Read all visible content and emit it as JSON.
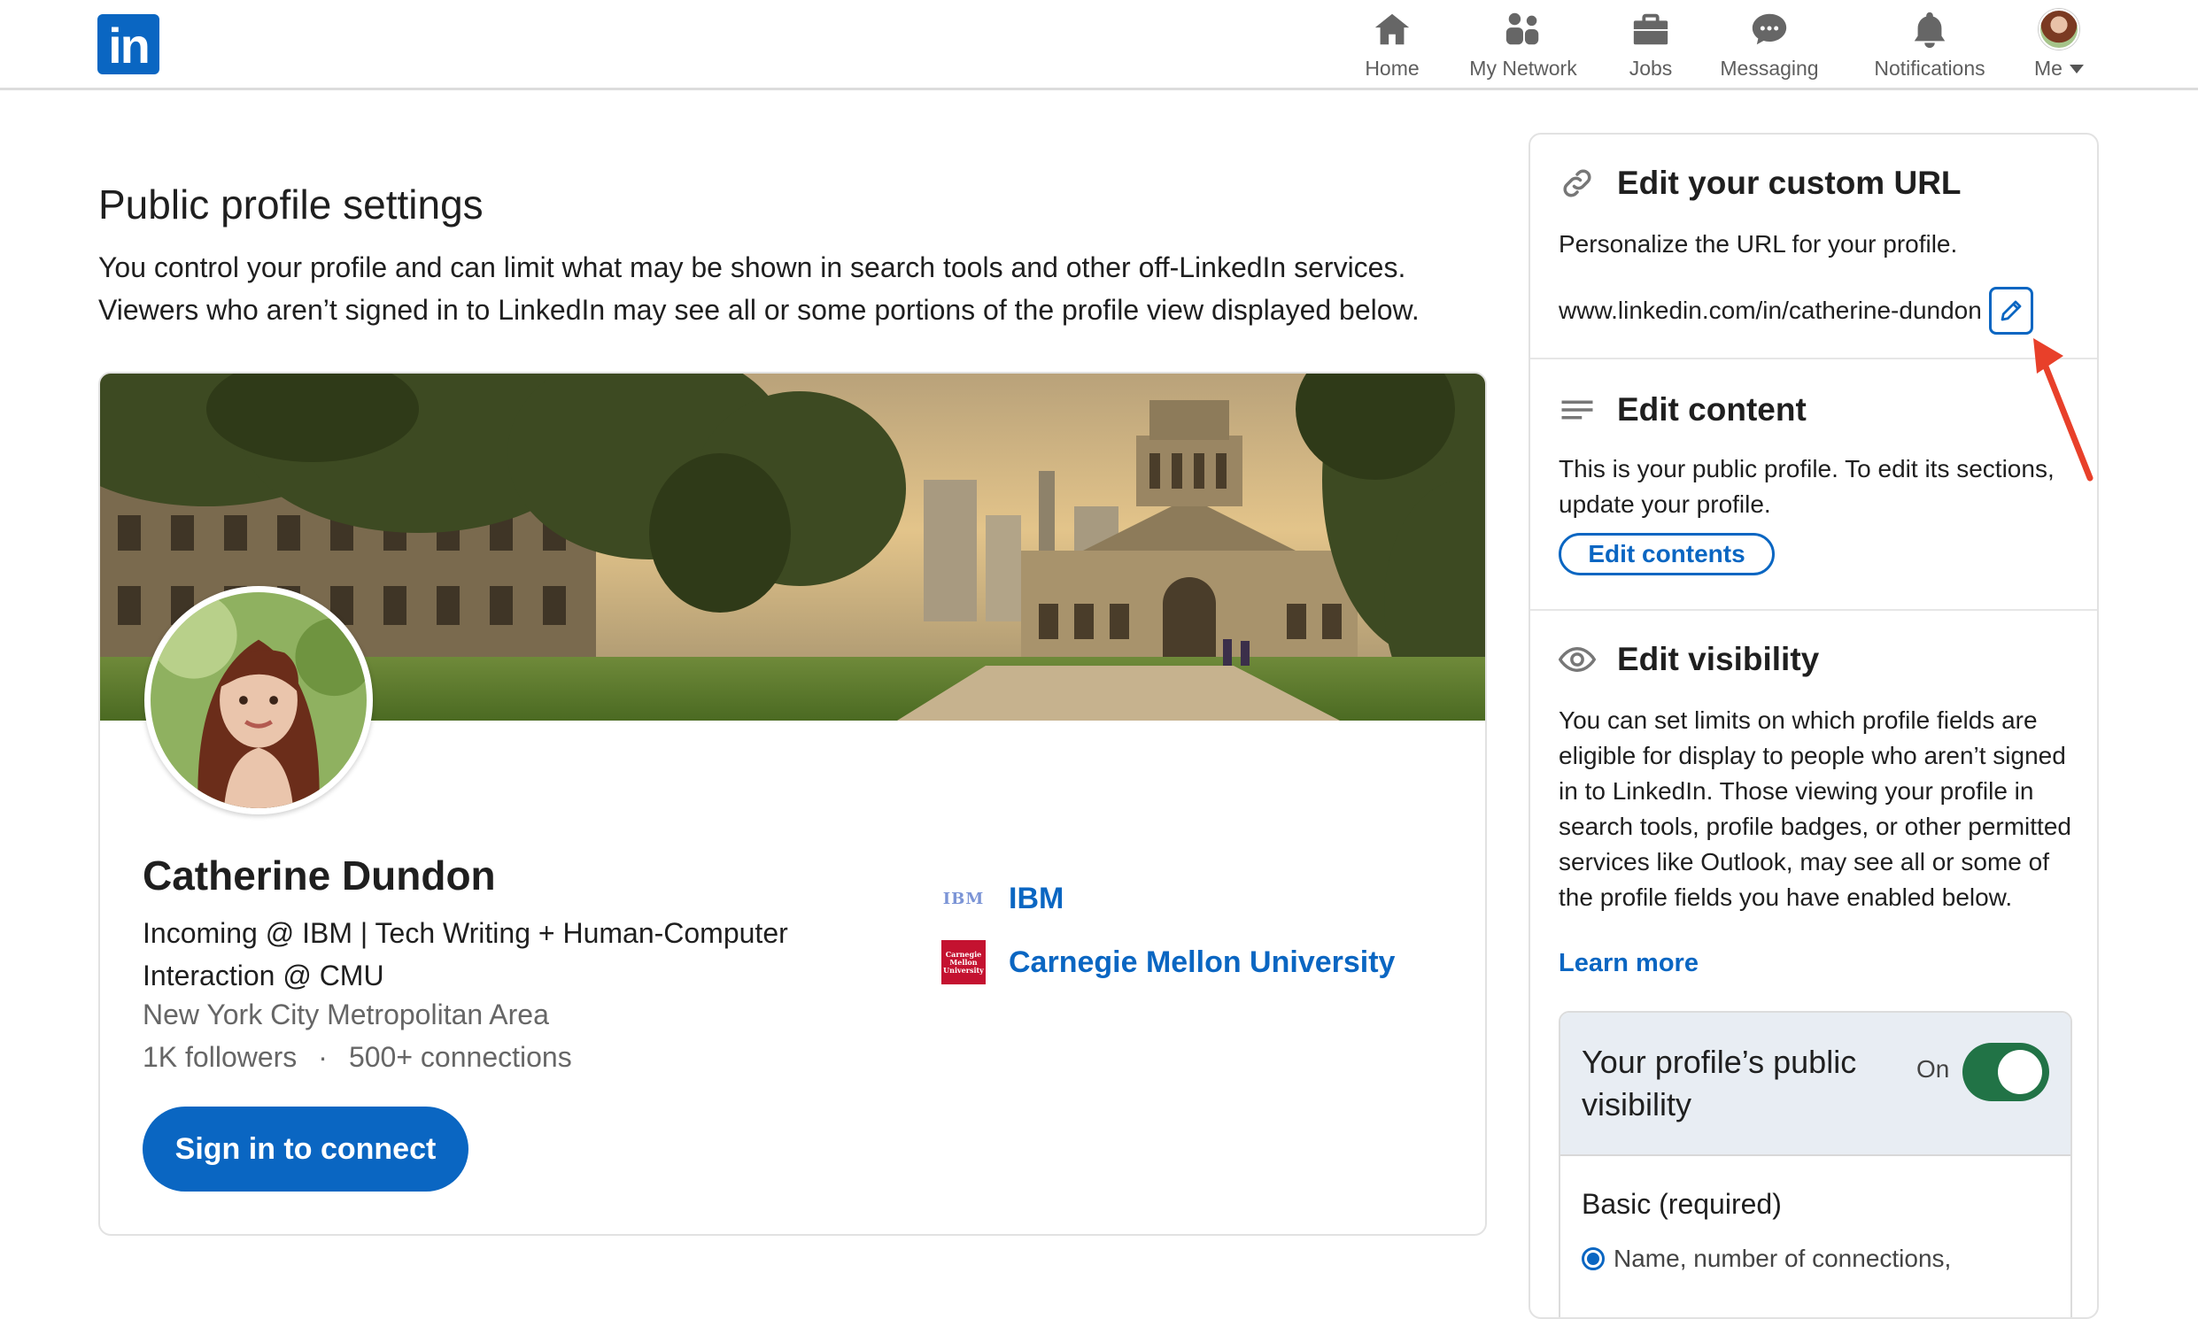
{
  "nav": {
    "logo": "in",
    "items": [
      {
        "label": "Home",
        "icon": "home-icon"
      },
      {
        "label": "My Network",
        "icon": "network-icon"
      },
      {
        "label": "Jobs",
        "icon": "briefcase-icon"
      },
      {
        "label": "Messaging",
        "icon": "messaging-icon"
      },
      {
        "label": "Notifications",
        "icon": "bell-icon"
      },
      {
        "label": "Me",
        "icon": "avatar"
      }
    ]
  },
  "main": {
    "title": "Public profile settings",
    "intro": "You control your profile and can limit what may be shown in search tools and other off-LinkedIn services. Viewers who aren’t signed in to LinkedIn may see all or some portions of the profile view displayed below."
  },
  "profile": {
    "name": "Catherine Dundon",
    "headline": "Incoming @ IBM | Tech Writing + Human-Computer Interaction @ CMU",
    "location": "New York City Metropolitan Area",
    "followers": "1K followers",
    "separator": "·",
    "connections": "500+ connections",
    "signin_label": "Sign in to connect",
    "orgs": [
      {
        "name": "IBM",
        "logo_text": "IBM"
      },
      {
        "name": "Carnegie Mellon University",
        "logo_text": "Carnegie Mellon University"
      }
    ]
  },
  "panel": {
    "url": {
      "title": "Edit your custom URL",
      "desc": "Personalize the URL for your profile.",
      "value": "www.linkedin.com/in/catherine-dundon"
    },
    "content": {
      "title": "Edit content",
      "desc": "This is your public profile. To edit its sections, update your profile.",
      "button": "Edit contents"
    },
    "visibility": {
      "title": "Edit visibility",
      "desc": "You can set limits on which profile fields are eligible for display to people who aren’t signed in to LinkedIn. Those viewing your profile in search tools, profile badges, or other permitted services like Outlook, may see all or some of the profile fields you have enabled below.",
      "learn_more": "Learn more",
      "public_title": "Your profile’s public visibility",
      "toggle_state": "On",
      "basic_label": "Basic (required)",
      "basic_item": "Name, number of connections,"
    }
  },
  "colors": {
    "accent": "#0a66c2",
    "toggle_on": "#217346",
    "annotation": "#e8402a"
  }
}
